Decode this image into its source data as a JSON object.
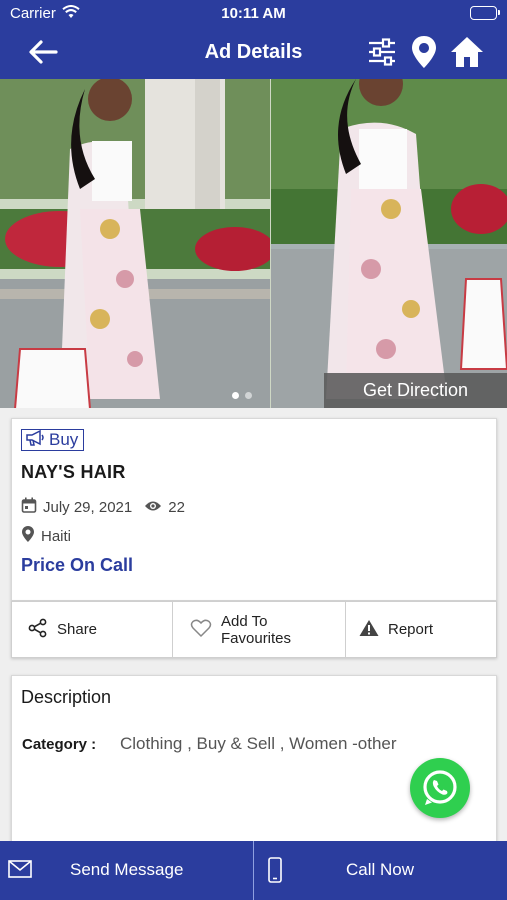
{
  "status_bar": {
    "carrier": "Carrier",
    "time": "10:11 AM"
  },
  "header": {
    "title": "Ad Details"
  },
  "gallery": {
    "image_count": 2,
    "active_index": 0,
    "get_direction": "Get Direction"
  },
  "ad": {
    "type_badge": "Buy",
    "title": "NAY'S HAIR",
    "date": "July 29, 2021",
    "views": "22",
    "location": "Haiti",
    "price": "Price On Call"
  },
  "actions": {
    "share": "Share",
    "favourites": "Add To Favourites",
    "report": "Report"
  },
  "description": {
    "heading": "Description",
    "category_label": "Category :",
    "category_value": "Clothing , Buy & Sell , Women -other"
  },
  "bottom_bar": {
    "send_message": "Send Message",
    "call_now": "Call Now"
  },
  "colors": {
    "primary": "#2b3d9e",
    "whatsapp": "#2fcf4f",
    "overlay": "#5a5a5a"
  },
  "icons": [
    "back-arrow-icon",
    "filter-sliders-icon",
    "map-pin-icon",
    "home-icon",
    "megaphone-icon",
    "calendar-icon",
    "eye-icon",
    "location-icon",
    "share-icon",
    "heart-icon",
    "warning-icon",
    "whatsapp-icon",
    "mail-icon",
    "phone-icon"
  ]
}
